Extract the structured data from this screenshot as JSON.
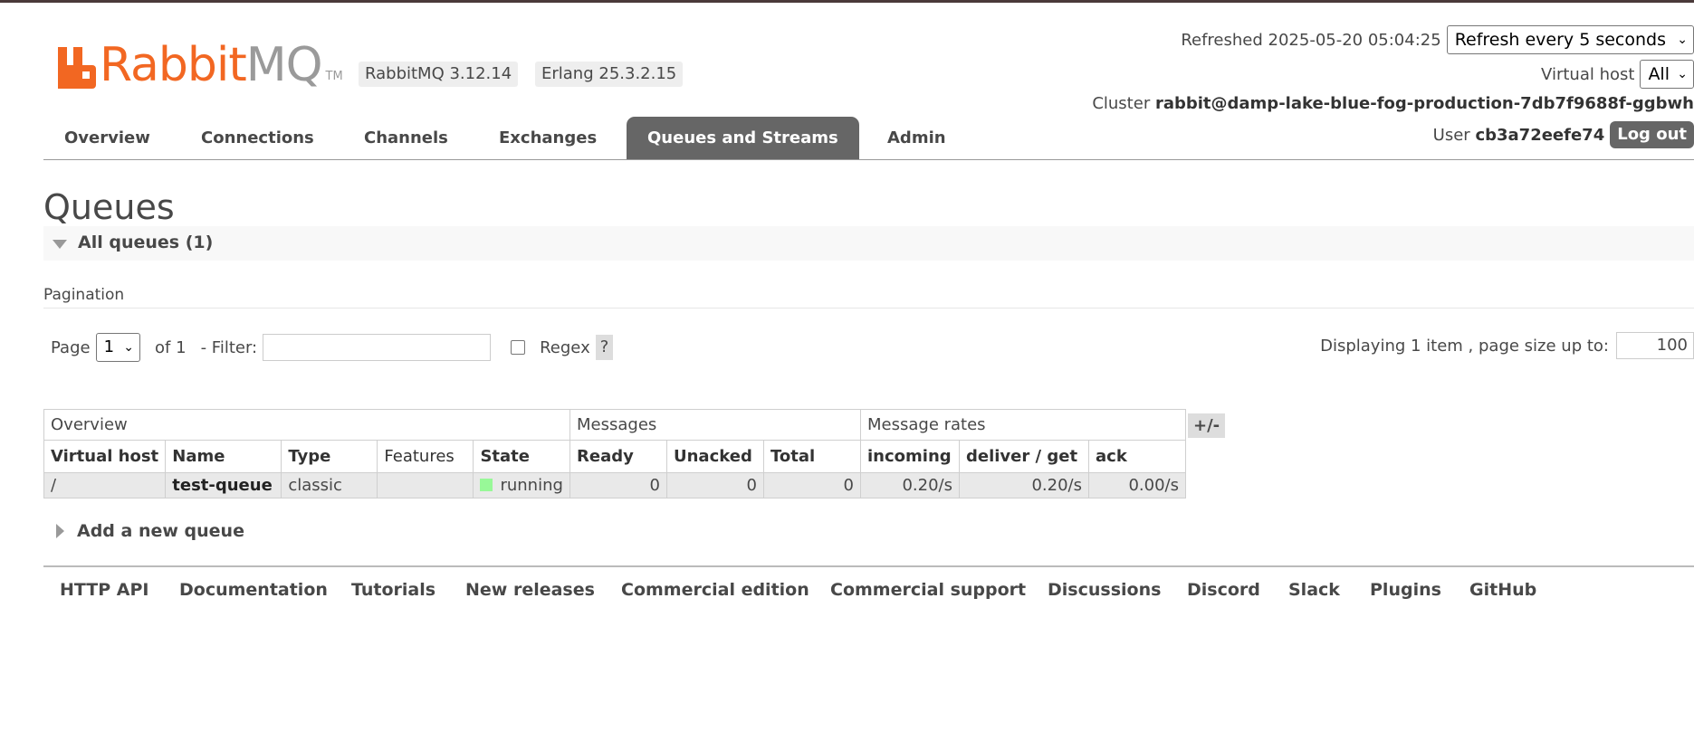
{
  "app": {
    "logo_rabbit": "Rabbit",
    "logo_mq": "MQ",
    "logo_tm": "TM",
    "version_badge": "RabbitMQ 3.12.14",
    "erlang_badge": "Erlang 25.3.2.15"
  },
  "header": {
    "refreshed_label": "Refreshed 2025-05-20 05:04:25",
    "refresh_select": "Refresh every 5 seconds",
    "vhost_label": "Virtual host",
    "vhost_select": "All",
    "cluster_label": "Cluster",
    "cluster_name": "rabbit@damp-lake-blue-fog-production-7db7f9688f-ggbwh",
    "user_label": "User",
    "user_name": "cb3a72eefe74",
    "logout": "Log out"
  },
  "nav": {
    "tabs": [
      "Overview",
      "Connections",
      "Channels",
      "Exchanges",
      "Queues and Streams",
      "Admin"
    ],
    "active": "Queues and Streams"
  },
  "page": {
    "title": "Queues",
    "section_title": "All queues (1)",
    "pagination_label": "Pagination",
    "page_label": "Page",
    "page_select": "1",
    "of_label": "of 1",
    "filter_label": "- Filter:",
    "filter_value": "",
    "regex_label": "Regex",
    "help": "?",
    "displaying": "Displaying 1 item , page size up to:",
    "page_size": "100"
  },
  "table": {
    "groups": [
      "Overview",
      "Messages",
      "Message rates"
    ],
    "columns": [
      "Virtual host",
      "Name",
      "Type",
      "Features",
      "State",
      "Ready",
      "Unacked",
      "Total",
      "incoming",
      "deliver / get",
      "ack"
    ],
    "rows": [
      {
        "vhost": "/",
        "name": "test-queue",
        "type": "classic",
        "features": "",
        "state": "running",
        "ready": "0",
        "unacked": "0",
        "total": "0",
        "incoming": "0.20/s",
        "deliver_get": "0.20/s",
        "ack": "0.00/s"
      }
    ],
    "toggle_columns": "+/-"
  },
  "add_queue": "Add a new queue",
  "footer": {
    "links": [
      "HTTP API",
      "Documentation",
      "Tutorials",
      "New releases",
      "Commercial edition",
      "Commercial support",
      "Discussions",
      "Discord",
      "Slack",
      "Plugins",
      "GitHub"
    ]
  },
  "colors": {
    "brand_orange": "#f26722",
    "tab_active": "#666666",
    "state_running": "#98f898"
  }
}
